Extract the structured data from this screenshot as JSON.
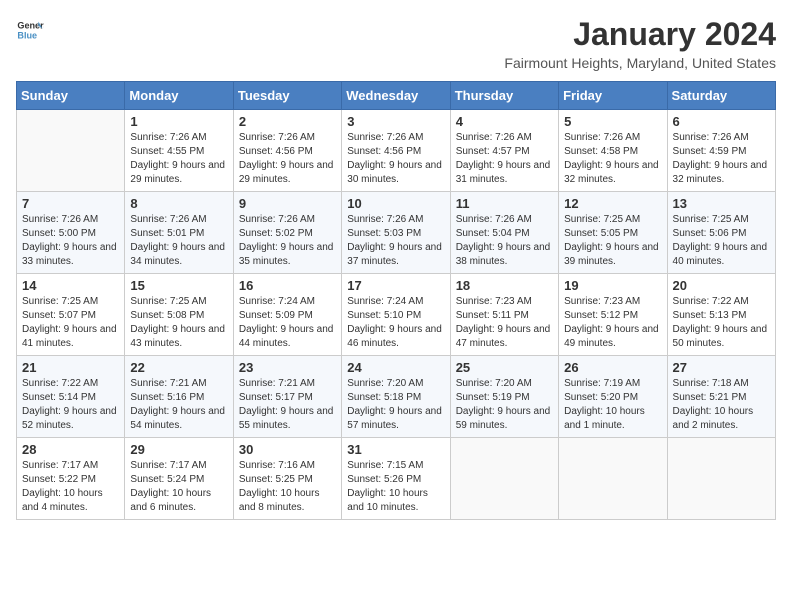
{
  "header": {
    "logo_line1": "General",
    "logo_line2": "Blue",
    "month": "January 2024",
    "location": "Fairmount Heights, Maryland, United States"
  },
  "weekdays": [
    "Sunday",
    "Monday",
    "Tuesday",
    "Wednesday",
    "Thursday",
    "Friday",
    "Saturday"
  ],
  "weeks": [
    [
      {
        "day": "",
        "sunrise": "",
        "sunset": "",
        "daylight": ""
      },
      {
        "day": "1",
        "sunrise": "Sunrise: 7:26 AM",
        "sunset": "Sunset: 4:55 PM",
        "daylight": "Daylight: 9 hours and 29 minutes."
      },
      {
        "day": "2",
        "sunrise": "Sunrise: 7:26 AM",
        "sunset": "Sunset: 4:56 PM",
        "daylight": "Daylight: 9 hours and 29 minutes."
      },
      {
        "day": "3",
        "sunrise": "Sunrise: 7:26 AM",
        "sunset": "Sunset: 4:56 PM",
        "daylight": "Daylight: 9 hours and 30 minutes."
      },
      {
        "day": "4",
        "sunrise": "Sunrise: 7:26 AM",
        "sunset": "Sunset: 4:57 PM",
        "daylight": "Daylight: 9 hours and 31 minutes."
      },
      {
        "day": "5",
        "sunrise": "Sunrise: 7:26 AM",
        "sunset": "Sunset: 4:58 PM",
        "daylight": "Daylight: 9 hours and 32 minutes."
      },
      {
        "day": "6",
        "sunrise": "Sunrise: 7:26 AM",
        "sunset": "Sunset: 4:59 PM",
        "daylight": "Daylight: 9 hours and 32 minutes."
      }
    ],
    [
      {
        "day": "7",
        "sunrise": "Sunrise: 7:26 AM",
        "sunset": "Sunset: 5:00 PM",
        "daylight": "Daylight: 9 hours and 33 minutes."
      },
      {
        "day": "8",
        "sunrise": "Sunrise: 7:26 AM",
        "sunset": "Sunset: 5:01 PM",
        "daylight": "Daylight: 9 hours and 34 minutes."
      },
      {
        "day": "9",
        "sunrise": "Sunrise: 7:26 AM",
        "sunset": "Sunset: 5:02 PM",
        "daylight": "Daylight: 9 hours and 35 minutes."
      },
      {
        "day": "10",
        "sunrise": "Sunrise: 7:26 AM",
        "sunset": "Sunset: 5:03 PM",
        "daylight": "Daylight: 9 hours and 37 minutes."
      },
      {
        "day": "11",
        "sunrise": "Sunrise: 7:26 AM",
        "sunset": "Sunset: 5:04 PM",
        "daylight": "Daylight: 9 hours and 38 minutes."
      },
      {
        "day": "12",
        "sunrise": "Sunrise: 7:25 AM",
        "sunset": "Sunset: 5:05 PM",
        "daylight": "Daylight: 9 hours and 39 minutes."
      },
      {
        "day": "13",
        "sunrise": "Sunrise: 7:25 AM",
        "sunset": "Sunset: 5:06 PM",
        "daylight": "Daylight: 9 hours and 40 minutes."
      }
    ],
    [
      {
        "day": "14",
        "sunrise": "Sunrise: 7:25 AM",
        "sunset": "Sunset: 5:07 PM",
        "daylight": "Daylight: 9 hours and 41 minutes."
      },
      {
        "day": "15",
        "sunrise": "Sunrise: 7:25 AM",
        "sunset": "Sunset: 5:08 PM",
        "daylight": "Daylight: 9 hours and 43 minutes."
      },
      {
        "day": "16",
        "sunrise": "Sunrise: 7:24 AM",
        "sunset": "Sunset: 5:09 PM",
        "daylight": "Daylight: 9 hours and 44 minutes."
      },
      {
        "day": "17",
        "sunrise": "Sunrise: 7:24 AM",
        "sunset": "Sunset: 5:10 PM",
        "daylight": "Daylight: 9 hours and 46 minutes."
      },
      {
        "day": "18",
        "sunrise": "Sunrise: 7:23 AM",
        "sunset": "Sunset: 5:11 PM",
        "daylight": "Daylight: 9 hours and 47 minutes."
      },
      {
        "day": "19",
        "sunrise": "Sunrise: 7:23 AM",
        "sunset": "Sunset: 5:12 PM",
        "daylight": "Daylight: 9 hours and 49 minutes."
      },
      {
        "day": "20",
        "sunrise": "Sunrise: 7:22 AM",
        "sunset": "Sunset: 5:13 PM",
        "daylight": "Daylight: 9 hours and 50 minutes."
      }
    ],
    [
      {
        "day": "21",
        "sunrise": "Sunrise: 7:22 AM",
        "sunset": "Sunset: 5:14 PM",
        "daylight": "Daylight: 9 hours and 52 minutes."
      },
      {
        "day": "22",
        "sunrise": "Sunrise: 7:21 AM",
        "sunset": "Sunset: 5:16 PM",
        "daylight": "Daylight: 9 hours and 54 minutes."
      },
      {
        "day": "23",
        "sunrise": "Sunrise: 7:21 AM",
        "sunset": "Sunset: 5:17 PM",
        "daylight": "Daylight: 9 hours and 55 minutes."
      },
      {
        "day": "24",
        "sunrise": "Sunrise: 7:20 AM",
        "sunset": "Sunset: 5:18 PM",
        "daylight": "Daylight: 9 hours and 57 minutes."
      },
      {
        "day": "25",
        "sunrise": "Sunrise: 7:20 AM",
        "sunset": "Sunset: 5:19 PM",
        "daylight": "Daylight: 9 hours and 59 minutes."
      },
      {
        "day": "26",
        "sunrise": "Sunrise: 7:19 AM",
        "sunset": "Sunset: 5:20 PM",
        "daylight": "Daylight: 10 hours and 1 minute."
      },
      {
        "day": "27",
        "sunrise": "Sunrise: 7:18 AM",
        "sunset": "Sunset: 5:21 PM",
        "daylight": "Daylight: 10 hours and 2 minutes."
      }
    ],
    [
      {
        "day": "28",
        "sunrise": "Sunrise: 7:17 AM",
        "sunset": "Sunset: 5:22 PM",
        "daylight": "Daylight: 10 hours and 4 minutes."
      },
      {
        "day": "29",
        "sunrise": "Sunrise: 7:17 AM",
        "sunset": "Sunset: 5:24 PM",
        "daylight": "Daylight: 10 hours and 6 minutes."
      },
      {
        "day": "30",
        "sunrise": "Sunrise: 7:16 AM",
        "sunset": "Sunset: 5:25 PM",
        "daylight": "Daylight: 10 hours and 8 minutes."
      },
      {
        "day": "31",
        "sunrise": "Sunrise: 7:15 AM",
        "sunset": "Sunset: 5:26 PM",
        "daylight": "Daylight: 10 hours and 10 minutes."
      },
      {
        "day": "",
        "sunrise": "",
        "sunset": "",
        "daylight": ""
      },
      {
        "day": "",
        "sunrise": "",
        "sunset": "",
        "daylight": ""
      },
      {
        "day": "",
        "sunrise": "",
        "sunset": "",
        "daylight": ""
      }
    ]
  ]
}
